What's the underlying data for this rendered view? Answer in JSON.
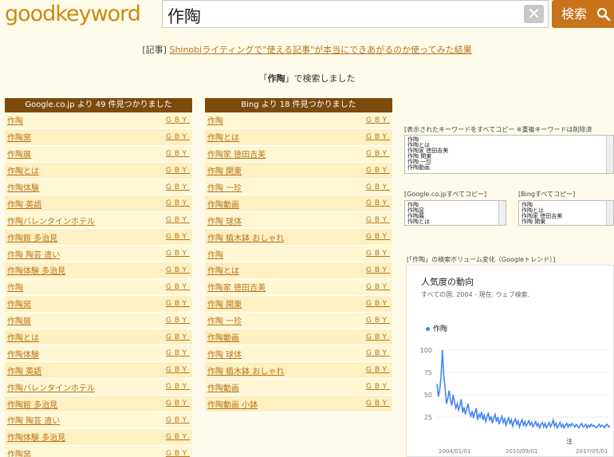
{
  "header": {
    "logo": "goodkeyword",
    "search_value": "作陶",
    "clear_label": "✕",
    "search_label": "検索"
  },
  "article": {
    "prefix": "[記事]",
    "link": "Shinobiライティングで\"使える記事\"が本当にできあがるのか使ってみた結果"
  },
  "searched": {
    "open": "「",
    "keyword": "作陶",
    "close": "」で検索しました"
  },
  "google": {
    "header": "Google.co.jp より 49 件見つかりました",
    "items": [
      "作陶",
      "作陶窯",
      "作陶展",
      "作陶とは",
      "作陶体験",
      "作陶 英語",
      "作陶バレンタインホテル",
      "作陶館 多治見",
      "作陶 陶芸 違い",
      "作陶体験 多治見",
      "作陶",
      "作陶窯",
      "作陶展",
      "作陶とは",
      "作陶体験",
      "作陶 英語",
      "作陶バレンタインホテル",
      "作陶館 多治見",
      "作陶 陶芸 違い",
      "作陶体験 多治見",
      "作陶窯"
    ]
  },
  "bing": {
    "header": "Bing より 18 件見つかりました",
    "items": [
      "作陶",
      "作陶とは",
      "作陶家 徳田吉美",
      "作陶 関東",
      "作陶 一珍",
      "作陶動画",
      "作陶 球体",
      "作陶 植木鉢 おしゃれ",
      "作陶",
      "作陶とは",
      "作陶家 徳田吉美",
      "作陶 関東",
      "作陶 一珍",
      "作陶動画",
      "作陶 球体",
      "作陶 植木鉢 おしゃれ",
      "作陶動画",
      "作陶動画 小鉢"
    ]
  },
  "gby": {
    "g": "G",
    "b": "B",
    "y": "Y"
  },
  "copy": {
    "all_label": "[表示されたキーワードをすべてコピー ※重複キーワードは削除済",
    "all_lines": [
      "作陶",
      "作陶とは",
      "作陶家 徳田吉美",
      "作陶 関東",
      "作陶 一珍",
      "作陶動画"
    ],
    "google_label": "[Google.co.jpすべてコピー]",
    "google_lines": [
      "作陶",
      "作陶窯",
      "作陶展",
      "作陶とは"
    ],
    "bing_label": "[Bingすべてコピー]",
    "bing_lines": [
      "作陶",
      "作陶とは",
      "作陶家 徳田吉美",
      "作陶 関東"
    ]
  },
  "trend": {
    "label": "[「作陶」の検索ボリューム変化（Googleトレンド）]",
    "title": "人気度の動向",
    "subtitle": "すべての国. 2004 - 現在. ウェブ検索.",
    "note": "注"
  },
  "chart_data": {
    "type": "line",
    "series": [
      {
        "name": "作陶",
        "color": "#4285f4"
      }
    ],
    "x_ticks": [
      "2004/01/01",
      "2010/09/01",
      "2017/05/01"
    ],
    "y_ticks": [
      100,
      75,
      50,
      25
    ],
    "ylim": [
      0,
      100
    ],
    "values": [
      62,
      48,
      55,
      70,
      100,
      72,
      58,
      40,
      46,
      55,
      44,
      38,
      50,
      42,
      35,
      40,
      33,
      38,
      45,
      30,
      36,
      28,
      34,
      40,
      30,
      26,
      32,
      24,
      30,
      35,
      22,
      28,
      25,
      31,
      22,
      27,
      20,
      25,
      30,
      21,
      26,
      18,
      24,
      28,
      20,
      25,
      17,
      22,
      26,
      19,
      23,
      16,
      21,
      24,
      18,
      22,
      15,
      20,
      23,
      17,
      21,
      14,
      19,
      22,
      16,
      20,
      15,
      18,
      21,
      16,
      19,
      14,
      17,
      20,
      15,
      18,
      13,
      17,
      19,
      14,
      18,
      13,
      16,
      19,
      14,
      17,
      22,
      15,
      18,
      13,
      16,
      19,
      14,
      17,
      13,
      16,
      18,
      14,
      17,
      15,
      18,
      16,
      14,
      17,
      15,
      13,
      16,
      18,
      14,
      15,
      17,
      13,
      16,
      14,
      17,
      15,
      16,
      14,
      13,
      15,
      17,
      14,
      16,
      15,
      13,
      16,
      17,
      14,
      15
    ]
  },
  "colors": {
    "accent": "#c6731a",
    "header_bg": "#7d4a0e",
    "link": "#b8741a",
    "line": "#4285f4"
  }
}
